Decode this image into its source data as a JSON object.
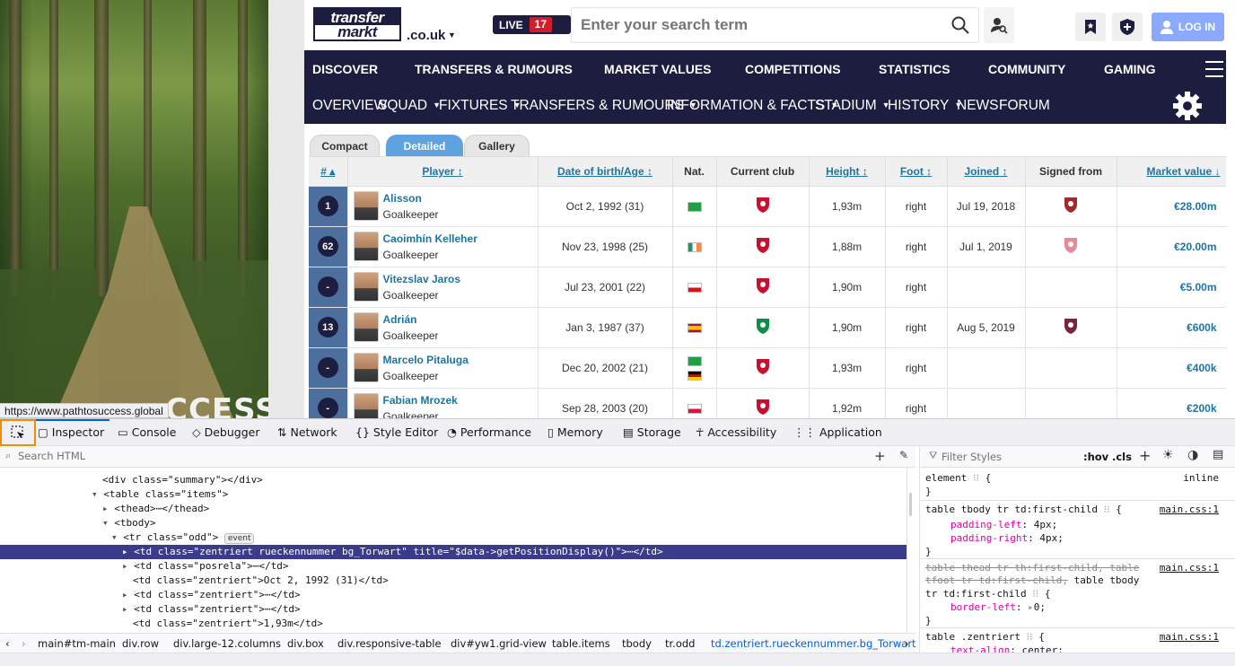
{
  "status_url": "https://www.pathtosuccess.global",
  "banner_fragment": "CCESS",
  "header": {
    "logo_top": "transfer",
    "logo_bottom": "markt",
    "logo_domain": ".co.uk",
    "live_label": "LIVE",
    "live_count": "17",
    "search_placeholder": "Enter your search term",
    "login_label": "LOG IN"
  },
  "main_nav": [
    "DISCOVER",
    "TRANSFERS & RUMOURS",
    "MARKET VALUES",
    "COMPETITIONS",
    "STATISTICS",
    "COMMUNITY",
    "GAMING"
  ],
  "sub_nav": [
    "OVERVIEW",
    "SQUAD",
    "FIXTURES",
    "TRANSFERS & RUMOURS",
    "INFORMATION & FACTS",
    "STADIUM",
    "HISTORY",
    "NEWS",
    "FORUM"
  ],
  "view_tabs": [
    "Compact",
    "Detailed",
    "Gallery"
  ],
  "table": {
    "headers": [
      "#",
      "Player",
      "Date of birth/Age",
      "Nat.",
      "Current club",
      "Height",
      "Foot",
      "Joined",
      "Signed from",
      "Market value"
    ],
    "rows": [
      {
        "num": "1",
        "name": "Alisson",
        "pos": "Goalkeeper",
        "dob": "Oct 2, 1992 (31)",
        "height": "1,93m",
        "foot": "right",
        "joined": "Jul 19, 2018",
        "value": "€28.00m"
      },
      {
        "num": "62",
        "name": "Caoimhín Kelleher",
        "pos": "Goalkeeper",
        "dob": "Nov 23, 1998 (25)",
        "height": "1,88m",
        "foot": "right",
        "joined": "Jul 1, 2019",
        "value": "€20.00m"
      },
      {
        "num": "-",
        "name": "Vitezslav Jaros",
        "pos": "Goalkeeper",
        "dob": "Jul 23, 2001 (22)",
        "height": "1,90m",
        "foot": "right",
        "joined": "",
        "value": "€5.00m"
      },
      {
        "num": "13",
        "name": "Adrián",
        "pos": "Goalkeeper",
        "dob": "Jan 3, 1987 (37)",
        "height": "1,90m",
        "foot": "right",
        "joined": "Aug 5, 2019",
        "value": "€600k"
      },
      {
        "num": "-",
        "name": "Marcelo Pitaluga",
        "pos": "Goalkeeper",
        "dob": "Dec 20, 2002 (21)",
        "height": "1,93m",
        "foot": "right",
        "joined": "",
        "value": "€400k"
      },
      {
        "num": "-",
        "name": "Fabian Mrozek",
        "pos": "Goalkeeper",
        "dob": "Sep 28, 2003 (20)",
        "height": "1,92m",
        "foot": "right",
        "joined": "",
        "value": "€200k"
      }
    ]
  },
  "devtools": {
    "tabs": [
      "Inspector",
      "Console",
      "Debugger",
      "Network",
      "Style Editor",
      "Performance",
      "Memory",
      "Storage",
      "Accessibility",
      "Application"
    ],
    "search_html": "Search HTML",
    "filter_styles": "Filter Styles",
    "hov": ":hov",
    "cls": ".cls",
    "breadcrumbs": [
      "main#tm-main",
      "div.row",
      "div.large-12.columns",
      "div.box",
      "div.responsive-table",
      "div#yw1.grid-view",
      "table.items",
      "tbody",
      "tr.odd",
      "td.zentriert.rueckennummer.bg_Torwart"
    ],
    "event_badge": "event",
    "html_lines": {
      "summary": "<div class=\"summary\"></div>",
      "table": "<table class=\"items\">",
      "thead": "<thead>⋯</thead>",
      "tbody": "<tbody>",
      "tr": "<tr class=\"odd\">",
      "td_sel": "<td class=\"zentriert rueckennummer bg_Torwart\" title=\"$data->getPositionDisplay()\">⋯</td>",
      "td_posrela": "<td class=\"posrela\">⋯</td>",
      "td_dob": "<td class=\"zentriert\">Oct 2, 1992 (31)</td>",
      "td_z1": "<td class=\"zentriert\">⋯</td>",
      "td_z2": "<td class=\"zentriert\">⋯</td>",
      "td_h": "<td class=\"zentriert\">1,93m</td>"
    },
    "rules": {
      "element": "element",
      "inline": "inline",
      "r1_sel": "table tbody tr td:first-child",
      "r1_src": "main.css:1",
      "r1_p1": "padding-left",
      "r1_v1": "4px;",
      "r1_p2": "padding-right",
      "r1_v2": "4px;",
      "r2_sel_a": "table thead tr th:first-child, table",
      "r2_sel_b": "tfoot tr td:first-child,",
      "r2_sel_c": "table tbody",
      "r2_sel_d": "tr td:first-child",
      "r2_src": "main.css:1",
      "r2_p": "border-left",
      "r2_v": "0;",
      "r3_sel": "table .zentriert",
      "r3_src": "main.css:1",
      "r3_p": "text-align",
      "r3_v": "center;"
    }
  }
}
